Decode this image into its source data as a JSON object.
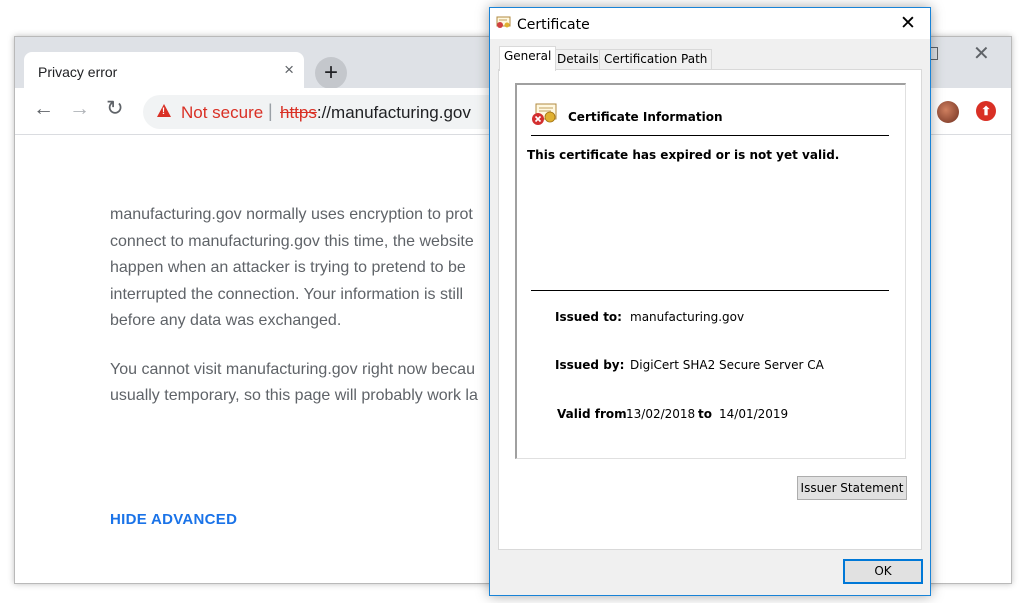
{
  "browser": {
    "tab": {
      "title": "Privacy error",
      "close_glyph": "×"
    },
    "new_tab_glyph": "+",
    "window_close_glyph": "✕",
    "toolbar": {
      "back_glyph": "←",
      "forward_glyph": "→",
      "reload_glyph": "↻",
      "security_label": "Not secure",
      "separator": "|",
      "url_scheme": "https",
      "url_rest": "://manufacturing.gov",
      "extension_glyph": "⬆"
    },
    "content": {
      "paragraph1_lines": [
        "manufacturing.gov normally uses encryption to prot",
        "connect to manufacturing.gov this time, the website",
        "happen when an attacker is trying to pretend to be",
        "interrupted the connection. Your information is still",
        "before any data was exchanged."
      ],
      "paragraph2_lines": [
        "You cannot visit manufacturing.gov right now becau",
        "usually temporary, so this page will probably work la"
      ],
      "hide_advanced": "HIDE ADVANCED"
    },
    "colors": {
      "danger": "#d93025",
      "link": "#1a73e8",
      "text": "#5f6368"
    }
  },
  "dialog": {
    "title": "Certificate",
    "close_glyph": "✕",
    "tabs": [
      {
        "label": "General",
        "active": true
      },
      {
        "label": "Details",
        "active": false
      },
      {
        "label": "Certification Path",
        "active": false
      }
    ],
    "info_title": "Certificate Information",
    "status": "This certificate has expired or is not yet valid.",
    "issued_to_label": "Issued to:",
    "issued_to": "manufacturing.gov",
    "issued_by_label": "Issued by:",
    "issued_by": "DigiCert SHA2 Secure Server CA",
    "valid_from_label": "Valid from",
    "valid_from": "13/02/2018",
    "to_label": "to",
    "valid_to": "14/01/2019",
    "issuer_statement_button": "Issuer Statement",
    "ok_button": "OK",
    "colors": {
      "accent": "#0078d7"
    }
  }
}
